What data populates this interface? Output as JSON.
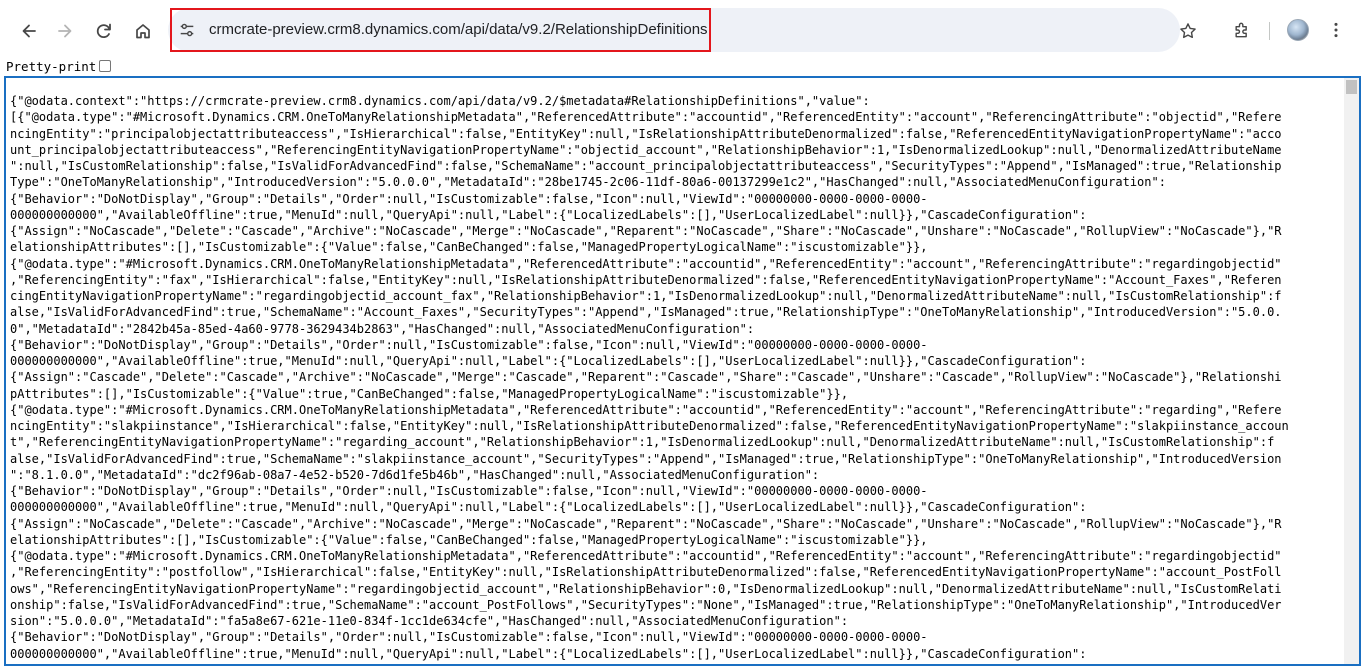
{
  "browser": {
    "url": "crmcrate-preview.crm8.dynamics.com/api/data/v9.2/RelationshipDefinitions",
    "icons": {
      "back": "arrow-left-icon",
      "forward": "arrow-right-icon",
      "reload": "reload-icon",
      "home": "home-icon",
      "site_info": "tune-icon",
      "bookmark": "star-icon",
      "extensions": "puzzle-icon",
      "menu": "kebab-menu-icon"
    },
    "accent_color": "#e3161c"
  },
  "pretty_print": {
    "label": "Pretty-print",
    "checked": false
  },
  "panel_border_color": "#1a6fc2",
  "json_lines": [
    "{\"@odata.context\":\"https://crmcrate-preview.crm8.dynamics.com/api/data/v9.2/$metadata#RelationshipDefinitions\",\"value\":",
    "[{\"@odata.type\":\"#Microsoft.Dynamics.CRM.OneToManyRelationshipMetadata\",\"ReferencedAttribute\":\"accountid\",\"ReferencedEntity\":\"account\",\"ReferencingAttribute\":\"objectid\",\"Refere",
    "ncingEntity\":\"principalobjectattributeaccess\",\"IsHierarchical\":false,\"EntityKey\":null,\"IsRelationshipAttributeDenormalized\":false,\"ReferencedEntityNavigationPropertyName\":\"acco",
    "unt_principalobjectattributeaccess\",\"ReferencingEntityNavigationPropertyName\":\"objectid_account\",\"RelationshipBehavior\":1,\"IsDenormalizedLookup\":null,\"DenormalizedAttributeName",
    "\":null,\"IsCustomRelationship\":false,\"IsValidForAdvancedFind\":false,\"SchemaName\":\"account_principalobjectattributeaccess\",\"SecurityTypes\":\"Append\",\"IsManaged\":true,\"Relationship",
    "Type\":\"OneToManyRelationship\",\"IntroducedVersion\":\"5.0.0.0\",\"MetadataId\":\"28be1745-2c06-11df-80a6-00137299e1c2\",\"HasChanged\":null,\"AssociatedMenuConfiguration\":",
    "{\"Behavior\":\"DoNotDisplay\",\"Group\":\"Details\",\"Order\":null,\"IsCustomizable\":false,\"Icon\":null,\"ViewId\":\"00000000-0000-0000-0000-",
    "000000000000\",\"AvailableOffline\":true,\"MenuId\":null,\"QueryApi\":null,\"Label\":{\"LocalizedLabels\":[],\"UserLocalizedLabel\":null}},\"CascadeConfiguration\":",
    "{\"Assign\":\"NoCascade\",\"Delete\":\"Cascade\",\"Archive\":\"NoCascade\",\"Merge\":\"NoCascade\",\"Reparent\":\"NoCascade\",\"Share\":\"NoCascade\",\"Unshare\":\"NoCascade\",\"RollupView\":\"NoCascade\"},\"R",
    "elationshipAttributes\":[],\"IsCustomizable\":{\"Value\":false,\"CanBeChanged\":false,\"ManagedPropertyLogicalName\":\"iscustomizable\"}},",
    "{\"@odata.type\":\"#Microsoft.Dynamics.CRM.OneToManyRelationshipMetadata\",\"ReferencedAttribute\":\"accountid\",\"ReferencedEntity\":\"account\",\"ReferencingAttribute\":\"regardingobjectid\"",
    ",\"ReferencingEntity\":\"fax\",\"IsHierarchical\":false,\"EntityKey\":null,\"IsRelationshipAttributeDenormalized\":false,\"ReferencedEntityNavigationPropertyName\":\"Account_Faxes\",\"Referen",
    "cingEntityNavigationPropertyName\":\"regardingobjectid_account_fax\",\"RelationshipBehavior\":1,\"IsDenormalizedLookup\":null,\"DenormalizedAttributeName\":null,\"IsCustomRelationship\":f",
    "alse,\"IsValidForAdvancedFind\":true,\"SchemaName\":\"Account_Faxes\",\"SecurityTypes\":\"Append\",\"IsManaged\":true,\"RelationshipType\":\"OneToManyRelationship\",\"IntroducedVersion\":\"5.0.0.",
    "0\",\"MetadataId\":\"2842b45a-85ed-4a60-9778-3629434b2863\",\"HasChanged\":null,\"AssociatedMenuConfiguration\":",
    "{\"Behavior\":\"DoNotDisplay\",\"Group\":\"Details\",\"Order\":null,\"IsCustomizable\":false,\"Icon\":null,\"ViewId\":\"00000000-0000-0000-0000-",
    "000000000000\",\"AvailableOffline\":true,\"MenuId\":null,\"QueryApi\":null,\"Label\":{\"LocalizedLabels\":[],\"UserLocalizedLabel\":null}},\"CascadeConfiguration\":",
    "{\"Assign\":\"Cascade\",\"Delete\":\"Cascade\",\"Archive\":\"NoCascade\",\"Merge\":\"Cascade\",\"Reparent\":\"Cascade\",\"Share\":\"Cascade\",\"Unshare\":\"Cascade\",\"RollupView\":\"NoCascade\"},\"Relationshi",
    "pAttributes\":[],\"IsCustomizable\":{\"Value\":true,\"CanBeChanged\":false,\"ManagedPropertyLogicalName\":\"iscustomizable\"}},",
    "{\"@odata.type\":\"#Microsoft.Dynamics.CRM.OneToManyRelationshipMetadata\",\"ReferencedAttribute\":\"accountid\",\"ReferencedEntity\":\"account\",\"ReferencingAttribute\":\"regarding\",\"Refere",
    "ncingEntity\":\"slakpiinstance\",\"IsHierarchical\":false,\"EntityKey\":null,\"IsRelationshipAttributeDenormalized\":false,\"ReferencedEntityNavigationPropertyName\":\"slakpiinstance_accoun",
    "t\",\"ReferencingEntityNavigationPropertyName\":\"regarding_account\",\"RelationshipBehavior\":1,\"IsDenormalizedLookup\":null,\"DenormalizedAttributeName\":null,\"IsCustomRelationship\":f",
    "alse,\"IsValidForAdvancedFind\":true,\"SchemaName\":\"slakpiinstance_account\",\"SecurityTypes\":\"Append\",\"IsManaged\":true,\"RelationshipType\":\"OneToManyRelationship\",\"IntroducedVersion",
    "\":\"8.1.0.0\",\"MetadataId\":\"dc2f96ab-08a7-4e52-b520-7d6d1fe5b46b\",\"HasChanged\":null,\"AssociatedMenuConfiguration\":",
    "{\"Behavior\":\"DoNotDisplay\",\"Group\":\"Details\",\"Order\":null,\"IsCustomizable\":false,\"Icon\":null,\"ViewId\":\"00000000-0000-0000-0000-",
    "000000000000\",\"AvailableOffline\":true,\"MenuId\":null,\"QueryApi\":null,\"Label\":{\"LocalizedLabels\":[],\"UserLocalizedLabel\":null}},\"CascadeConfiguration\":",
    "{\"Assign\":\"NoCascade\",\"Delete\":\"Cascade\",\"Archive\":\"NoCascade\",\"Merge\":\"NoCascade\",\"Reparent\":\"NoCascade\",\"Share\":\"NoCascade\",\"Unshare\":\"NoCascade\",\"RollupView\":\"NoCascade\"},\"R",
    "elationshipAttributes\":[],\"IsCustomizable\":{\"Value\":false,\"CanBeChanged\":false,\"ManagedPropertyLogicalName\":\"iscustomizable\"}},",
    "{\"@odata.type\":\"#Microsoft.Dynamics.CRM.OneToManyRelationshipMetadata\",\"ReferencedAttribute\":\"accountid\",\"ReferencedEntity\":\"account\",\"ReferencingAttribute\":\"regardingobjectid\"",
    ",\"ReferencingEntity\":\"postfollow\",\"IsHierarchical\":false,\"EntityKey\":null,\"IsRelationshipAttributeDenormalized\":false,\"ReferencedEntityNavigationPropertyName\":\"account_PostFoll",
    "ows\",\"ReferencingEntityNavigationPropertyName\":\"regardingobjectid_account\",\"RelationshipBehavior\":0,\"IsDenormalizedLookup\":null,\"DenormalizedAttributeName\":null,\"IsCustomRelati",
    "onship\":false,\"IsValidForAdvancedFind\":true,\"SchemaName\":\"account_PostFollows\",\"SecurityTypes\":\"None\",\"IsManaged\":true,\"RelationshipType\":\"OneToManyRelationship\",\"IntroducedVer",
    "sion\":\"5.0.0.0\",\"MetadataId\":\"fa5a8e67-621e-11e0-834f-1cc1de634cfe\",\"HasChanged\":null,\"AssociatedMenuConfiguration\":",
    "{\"Behavior\":\"DoNotDisplay\",\"Group\":\"Details\",\"Order\":null,\"IsCustomizable\":false,\"Icon\":null,\"ViewId\":\"00000000-0000-0000-0000-",
    "000000000000\",\"AvailableOffline\":true,\"MenuId\":null,\"QueryApi\":null,\"Label\":{\"LocalizedLabels\":[],\"UserLocalizedLabel\":null}},\"CascadeConfiguration\":"
  ]
}
